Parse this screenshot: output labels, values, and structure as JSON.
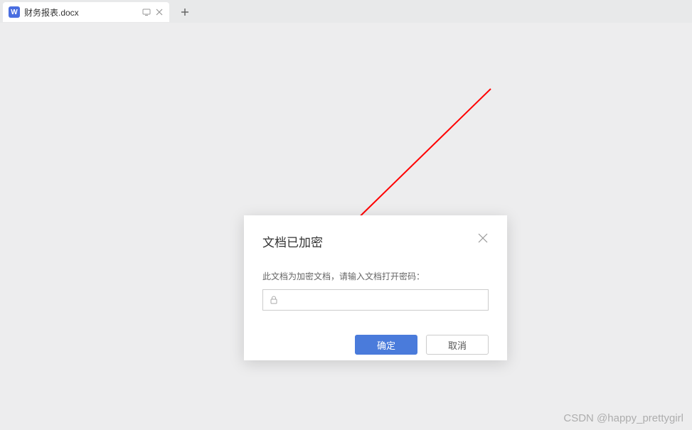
{
  "tab": {
    "icon_letter": "W",
    "title": "财务报表.docx"
  },
  "dialog": {
    "title": "文档已加密",
    "message": "此文档为加密文档，请输入文档打开密码：",
    "password_value": "",
    "confirm_label": "确定",
    "cancel_label": "取消"
  },
  "watermark": "CSDN @happy_prettygirl",
  "colors": {
    "primary": "#4a7bdb",
    "tab_icon": "#4a6ee0",
    "arrow": "#ff0000"
  }
}
